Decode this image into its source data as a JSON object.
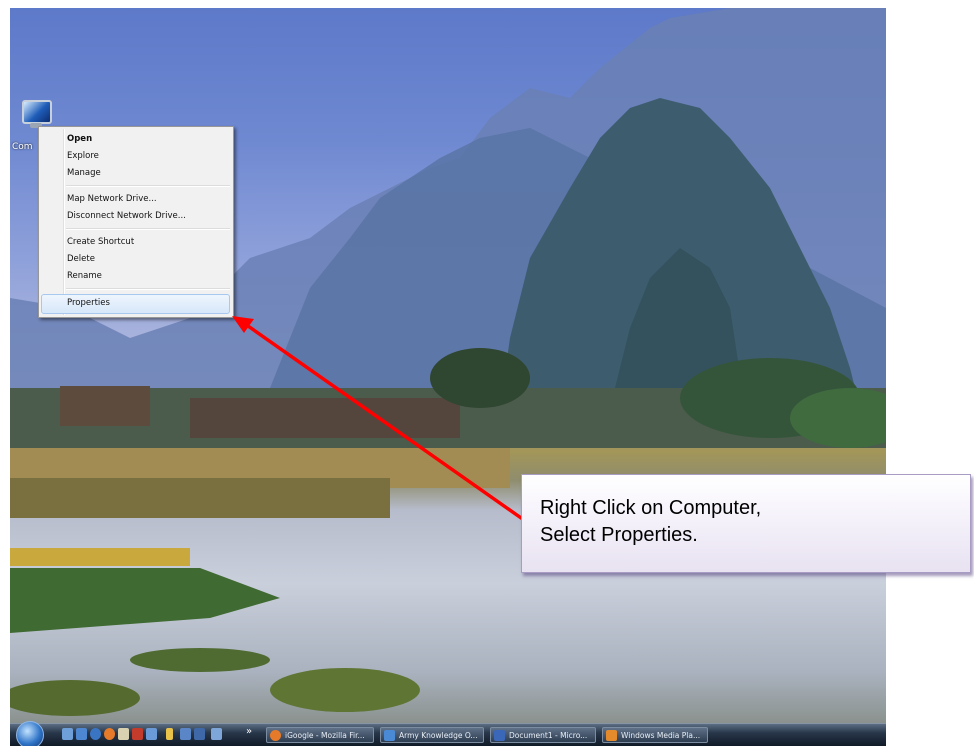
{
  "desktop": {
    "icon_label": "Com"
  },
  "context_menu": {
    "items": [
      {
        "label": "Open",
        "bold": true
      },
      {
        "label": "Explore"
      },
      {
        "label": "Manage"
      },
      {
        "label": "Map Network Drive..."
      },
      {
        "label": "Disconnect Network Drive..."
      },
      {
        "label": "Create Shortcut"
      },
      {
        "label": "Delete"
      },
      {
        "label": "Rename"
      },
      {
        "label": "Properties",
        "highlighted": true
      }
    ]
  },
  "taskbar": {
    "chevron": "»",
    "buttons": [
      {
        "label": "iGoogle - Mozilla Fir...",
        "icon": "firefox-icon"
      },
      {
        "label": "Army Knowledge O...",
        "icon": "browser-icon"
      },
      {
        "label": "Document1 - Micro...",
        "icon": "word-icon"
      },
      {
        "label": "Windows Media Pla...",
        "icon": "media-player-icon"
      }
    ]
  },
  "callout": {
    "line1": "Right Click on Computer,",
    "line2": "Select Properties."
  },
  "colors": {
    "arrow": "#ff0000",
    "menu_highlight": "#d7e7fa",
    "callout_border": "#a99cc4"
  }
}
